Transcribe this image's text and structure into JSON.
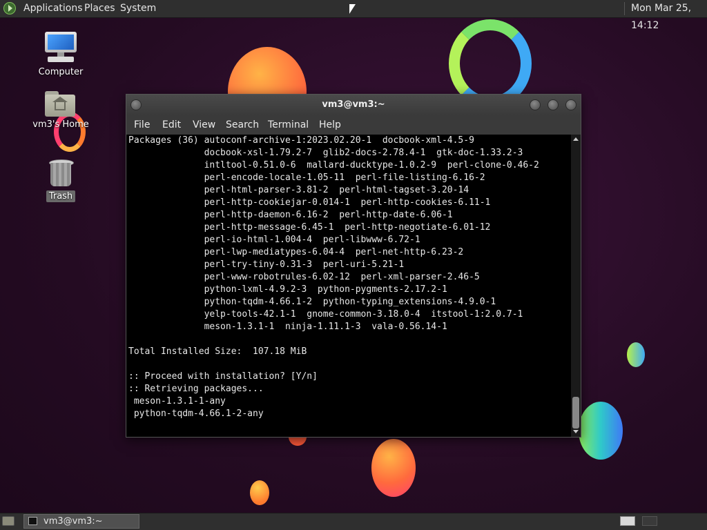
{
  "top_panel": {
    "menus": [
      "Applications",
      "Places",
      "System"
    ],
    "clock": "Mon Mar 25, 14:12"
  },
  "desktop_icons": [
    {
      "label": "Computer",
      "icon": "computer-icon"
    },
    {
      "label": "vm3's Home",
      "icon": "home-folder-icon"
    },
    {
      "label": "Trash",
      "icon": "trash-icon"
    }
  ],
  "terminal": {
    "title": "vm3@vm3:~",
    "menu": [
      "File",
      "Edit",
      "View",
      "Search",
      "Terminal",
      "Help"
    ],
    "lines": [
      "Packages (36) autoconf-archive-1:2023.02.20-1  docbook-xml-4.5-9",
      "              docbook-xsl-1.79.2-7  glib2-docs-2.78.4-1  gtk-doc-1.33.2-3",
      "              intltool-0.51.0-6  mallard-ducktype-1.0.2-9  perl-clone-0.46-2",
      "              perl-encode-locale-1.05-11  perl-file-listing-6.16-2",
      "              perl-html-parser-3.81-2  perl-html-tagset-3.20-14",
      "              perl-http-cookiejar-0.014-1  perl-http-cookies-6.11-1",
      "              perl-http-daemon-6.16-2  perl-http-date-6.06-1",
      "              perl-http-message-6.45-1  perl-http-negotiate-6.01-12",
      "              perl-io-html-1.004-4  perl-libwww-6.72-1",
      "              perl-lwp-mediatypes-6.04-4  perl-net-http-6.23-2",
      "              perl-try-tiny-0.31-3  perl-uri-5.21-1",
      "              perl-www-robotrules-6.02-12  perl-xml-parser-2.46-5",
      "              python-lxml-4.9.2-3  python-pygments-2.17.2-1",
      "              python-tqdm-4.66.1-2  python-typing_extensions-4.9.0-1",
      "              yelp-tools-42.1-1  gnome-common-3.18.0-4  itstool-1:2.0.7-1",
      "              meson-1.3.1-1  ninja-1.11.1-3  vala-0.56.14-1",
      "",
      "Total Installed Size:  107.18 MiB",
      "",
      ":: Proceed with installation? [Y/n]",
      ":: Retrieving packages...",
      " meson-1.3.1-1-any",
      " python-tqdm-4.66.1-2-any"
    ]
  },
  "taskbar": {
    "task_label": "vm3@vm3:~"
  },
  "colors": {
    "panel": "#2f2f2f",
    "terminal_bg": "#000000",
    "terminal_fg": "#e8e8e8"
  }
}
